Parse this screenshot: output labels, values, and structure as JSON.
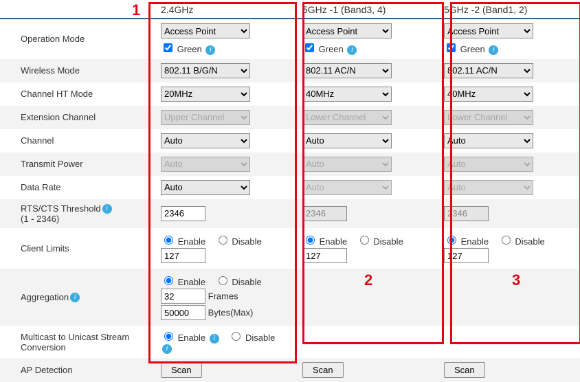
{
  "columns": {
    "c1": "2.4GHz",
    "c2": "5GHz -1 (Band3, 4)",
    "c3": "5GHz -2 (Band1, 2)"
  },
  "labels": {
    "operation_mode": "Operation Mode",
    "wireless_mode": "Wireless Mode",
    "channel_ht_mode": "Channel HT Mode",
    "extension_channel": "Extension Channel",
    "channel": "Channel",
    "transmit_power": "Transmit Power",
    "data_rate": "Data Rate",
    "rts_cts": "RTS/CTS Threshold",
    "rts_cts_range": "(1 - 2346)",
    "client_limits": "Client Limits",
    "aggregation": "Aggregation",
    "m2u": "Multicast to Unicast Stream Conversion",
    "ap_detection": "AP Detection",
    "green": "Green",
    "enable": "Enable",
    "disable": "Disable",
    "frames": "Frames",
    "bytes_max": "Bytes(Max)",
    "scan": "Scan"
  },
  "values": {
    "op_mode": "Access Point",
    "wmode_24": "802.11 B/G/N",
    "wmode_5": "802.11 AC/N",
    "ht_24": "20MHz",
    "ht_5": "40MHz",
    "ext_upper": "Upper Channel",
    "ext_lower": "Lower Channel",
    "auto": "Auto",
    "rts": "2346",
    "client_limit": "127",
    "agg_frames": "32",
    "agg_bytes": "50000"
  },
  "annotations": {
    "one": "1",
    "two": "2",
    "three": "3"
  }
}
